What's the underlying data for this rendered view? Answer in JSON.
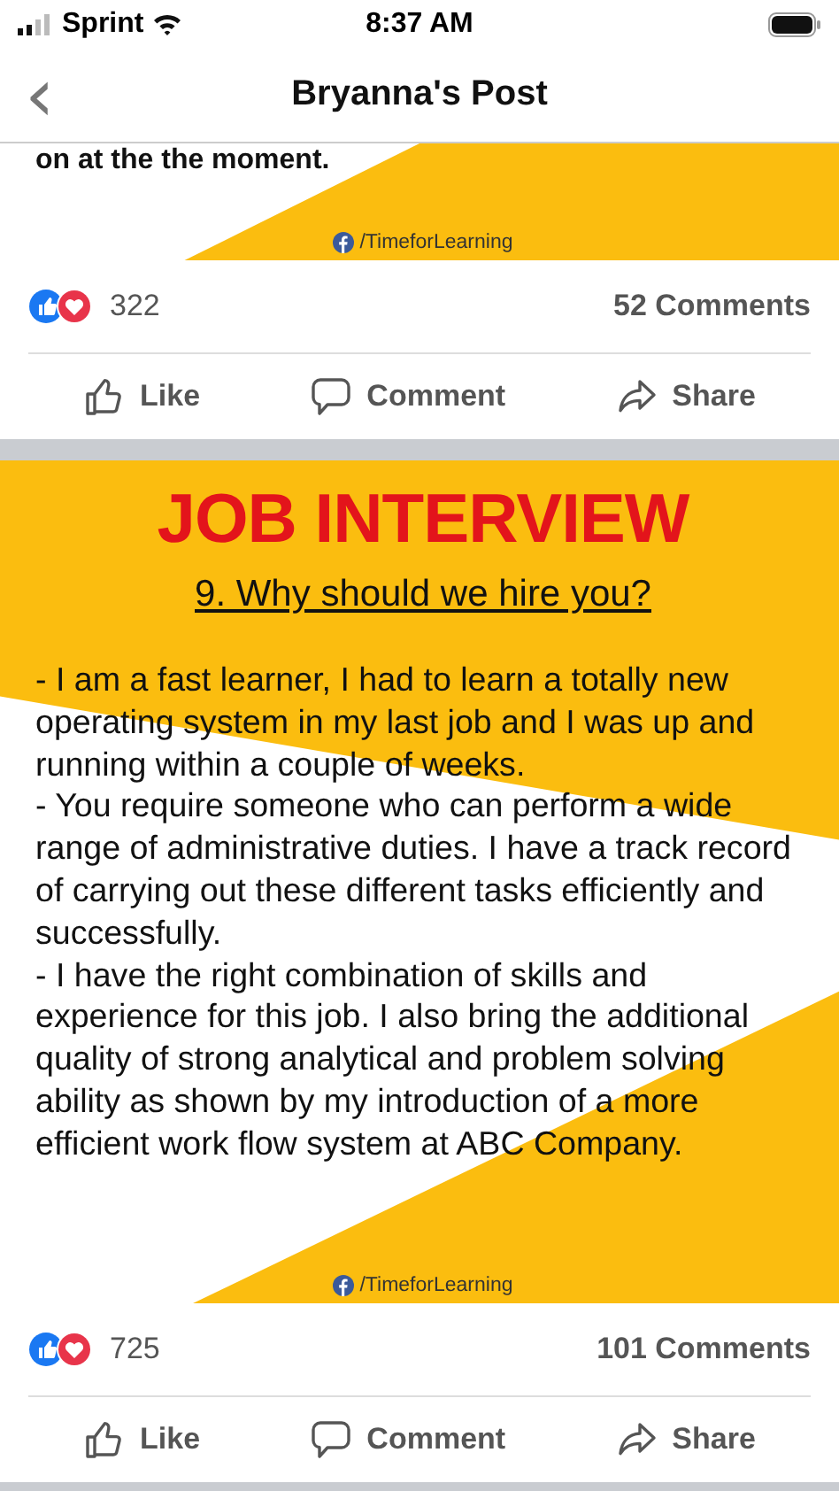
{
  "status_bar": {
    "carrier": "Sprint",
    "time": "8:37 AM"
  },
  "nav": {
    "back": "‹",
    "title": "Bryanna's Post"
  },
  "posts": [
    {
      "image": {
        "kind": "tail",
        "lines": [
          "on at the the moment."
        ],
        "footer": "/TimeforLearning"
      },
      "reactions": "322",
      "comments": "52 Comments",
      "actions": [
        {
          "kind": "like",
          "label": "Like"
        },
        {
          "kind": "comment",
          "label": "Comment"
        },
        {
          "kind": "share",
          "label": "Share"
        }
      ]
    },
    {
      "image": {
        "kind": "full",
        "heading": "JOB INTERVIEW",
        "question": "9. Why should we hire you?",
        "lines": [
          "- I am a fast learner, I had to learn a totally new operating system in my last job and I was up and running within a couple of weeks.",
          "- You require someone who can perform a wide range of administrative duties. I have a track record of carrying out these different tasks efficiently and successfully.",
          "- I have the right combination of skills and experience for this job. I also bring the additional quality of strong analytical and problem solving ability as shown by my introduction of a more efficient work flow system at ABC Company."
        ],
        "footer": "/TimeforLearning"
      },
      "reactions": "725",
      "comments": "101 Comments",
      "actions": [
        {
          "kind": "like",
          "label": "Like"
        },
        {
          "kind": "comment",
          "label": "Comment"
        },
        {
          "kind": "share",
          "label": "Share"
        }
      ]
    }
  ]
}
